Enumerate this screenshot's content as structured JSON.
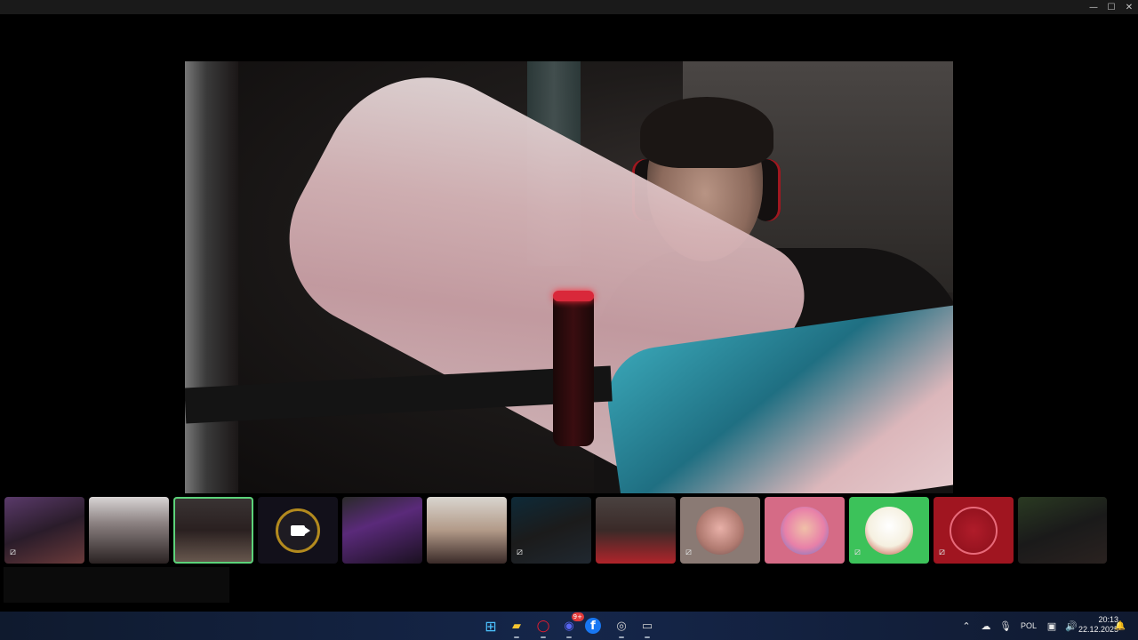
{
  "window": {
    "minimize_glyph": "—",
    "maximize_glyph": "☐",
    "close_glyph": "✕"
  },
  "main_video": {
    "stream_icon_name": "video-feed"
  },
  "participants": [
    {
      "muted": true,
      "style": "room-purple"
    },
    {
      "muted": false,
      "style": "laughing-girl"
    },
    {
      "muted": false,
      "style": "girl-headset",
      "active": true
    },
    {
      "muted": false,
      "style": "camera-off",
      "icon": "camera-icon"
    },
    {
      "muted": false,
      "style": "purple-room"
    },
    {
      "muted": false,
      "style": "glasses-headset"
    },
    {
      "muted": true,
      "style": "studio-red-headset"
    },
    {
      "muted": false,
      "style": "grey-hair"
    },
    {
      "muted": true,
      "style": "avatar-pink-glasses"
    },
    {
      "muted": false,
      "style": "avatar-pink-hair"
    },
    {
      "muted": true,
      "style": "avatar-green"
    },
    {
      "muted": true,
      "style": "avatar-red-money"
    },
    {
      "muted": false,
      "style": "plants-room"
    }
  ],
  "mute_glyph": "⧄",
  "taskbar": {
    "apps": [
      {
        "name": "start",
        "glyph": "⊞",
        "color": "#4cc2ff"
      },
      {
        "name": "file-explorer",
        "glyph": "▰",
        "color": "#f4c430"
      },
      {
        "name": "opera",
        "glyph": "◯",
        "color": "#ff1b2d"
      },
      {
        "name": "discord",
        "glyph": "◉",
        "color": "#5865f2",
        "badge": "9+"
      },
      {
        "name": "facebook",
        "glyph": "f",
        "color": "#1877f2"
      },
      {
        "name": "obs",
        "glyph": "◎",
        "color": "#cfcfcf"
      },
      {
        "name": "terminal",
        "glyph": "▭",
        "color": "#cfcfcf"
      }
    ],
    "tray": {
      "chevron": "⌃",
      "cloud": "☁",
      "mic": "🎙",
      "language": "POL",
      "display": "▣",
      "volume": "🔊",
      "time": "20:13",
      "date": "22.12.2025",
      "bell": "🔔"
    }
  }
}
